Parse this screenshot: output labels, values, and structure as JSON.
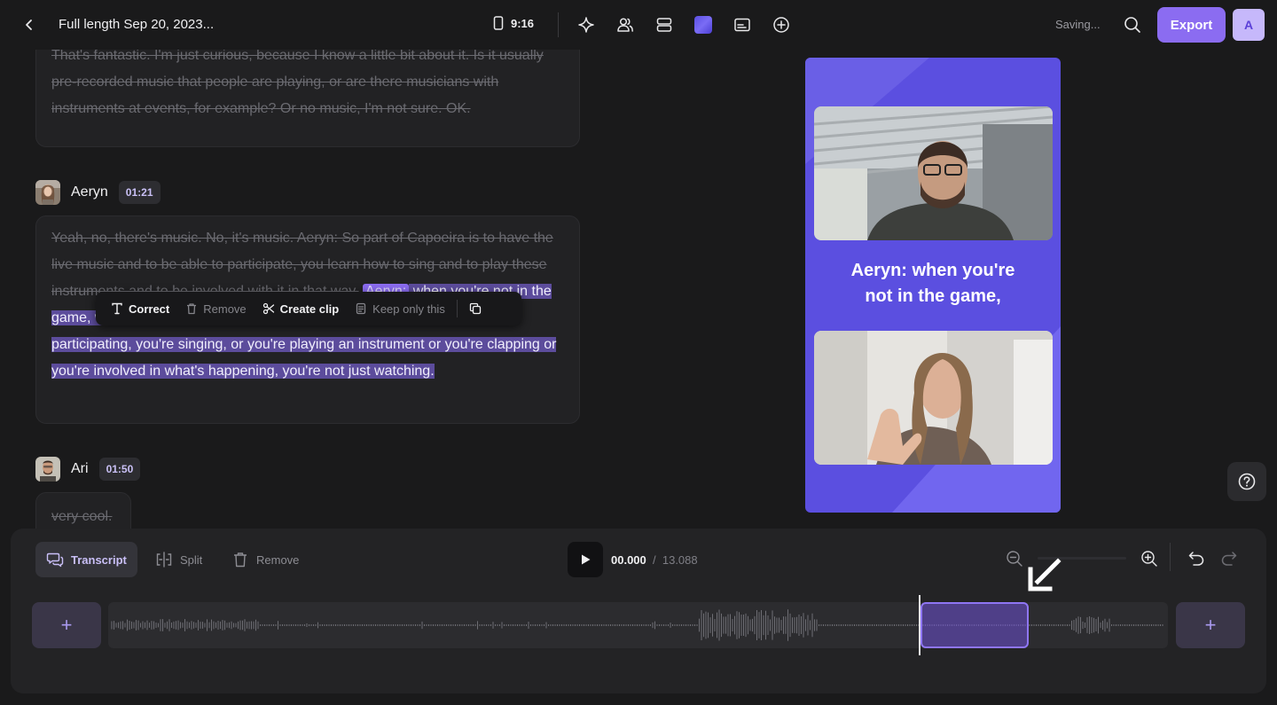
{
  "header": {
    "title": "Full length Sep 20, 2023...",
    "aspect_ratio": "9:16",
    "saving_status": "Saving...",
    "export_label": "Export",
    "avatar_initial": "A",
    "accent_color": "#8b6cf1"
  },
  "transcript": {
    "prev_paragraph": {
      "struck_text": "That's fantastic. I'm just curious, because I know a little bit about it. Is it usually pre-recorded music that people are playing, or are there musicians with instruments at events, for example? Or no music, I'm not sure. OK."
    },
    "speakers": [
      {
        "name": "Aeryn",
        "time": "01:21",
        "struck_text": "Yeah, no, there's music. No, it's music. Aeryn: So part of Capoeira is to have the live music and to be able to participate, you learn how to sing and to play these instruments and to be involved with it in that way.",
        "tag": "Aeryn:",
        "highlighted_text": " when you're not in the game, when you're not playing with another partner, you're actually like participating, you're singing, or you're playing an instrument or you're clapping or you're involved in what's happening, you're not just watching."
      },
      {
        "name": "Ari",
        "time": "01:50",
        "struck_text": "very cool."
      }
    ]
  },
  "context_menu": {
    "correct": "Correct",
    "remove": "Remove",
    "create_clip": "Create clip",
    "keep_only": "Keep only this"
  },
  "preview": {
    "caption_line1": "Aeryn: when you're",
    "caption_line2": "not in the game,",
    "bg_color": "#5b4fe0"
  },
  "timeline": {
    "transcript_label": "Transcript",
    "split_label": "Split",
    "remove_label": "Remove",
    "current_time": "00.000",
    "separator": "/",
    "total_time": "13.088",
    "add_symbol": "+"
  }
}
